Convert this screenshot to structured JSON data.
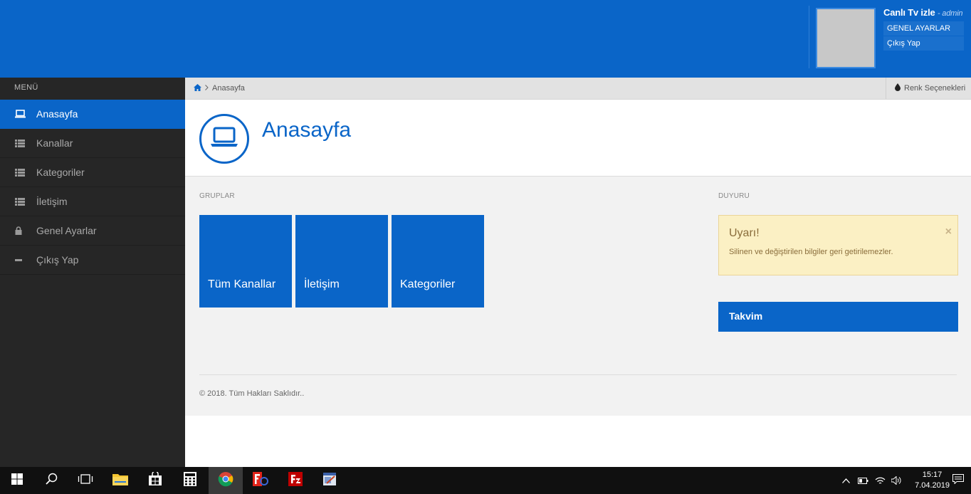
{
  "header": {
    "site_name": "Canlı Tv izle",
    "role": "- admin",
    "user_menu": [
      {
        "label": "GENEL AYARLAR"
      },
      {
        "label": "Çıkış Yap"
      }
    ]
  },
  "sidebar": {
    "title": "MENÜ",
    "items": [
      {
        "label": "Anasayfa",
        "icon": "laptop-icon",
        "active": true
      },
      {
        "label": "Kanallar",
        "icon": "list-icon"
      },
      {
        "label": "Kategoriler",
        "icon": "list-icon"
      },
      {
        "label": "İletişim",
        "icon": "list-icon"
      },
      {
        "label": "Genel Ayarlar",
        "icon": "lock-icon"
      },
      {
        "label": "Çıkış Yap",
        "icon": "minus-icon"
      }
    ]
  },
  "breadcrumb": {
    "current": "Anasayfa",
    "color_options": "Renk Seçenekleri"
  },
  "page": {
    "title": "Anasayfa"
  },
  "groups": {
    "label": "GRUPLAR",
    "tiles": [
      {
        "label": "Tüm Kanallar"
      },
      {
        "label": "İletişim"
      },
      {
        "label": "Kategoriler"
      }
    ]
  },
  "announcement": {
    "label": "DUYURU",
    "alert_title": "Uyarı!",
    "alert_text": "Silinen ve değiştirilen bilgiler geri getirilemezler.",
    "close": "×"
  },
  "calendar": {
    "label": "Takvim"
  },
  "footer": {
    "text": "© 2018. Tüm Hakları Saklıdır.."
  },
  "taskbar": {
    "time": "15:17",
    "date": "7.04.2019"
  },
  "colors": {
    "primary": "#0a65c8",
    "sidebar_bg": "#262626",
    "alert_bg": "#fbf0c4"
  }
}
